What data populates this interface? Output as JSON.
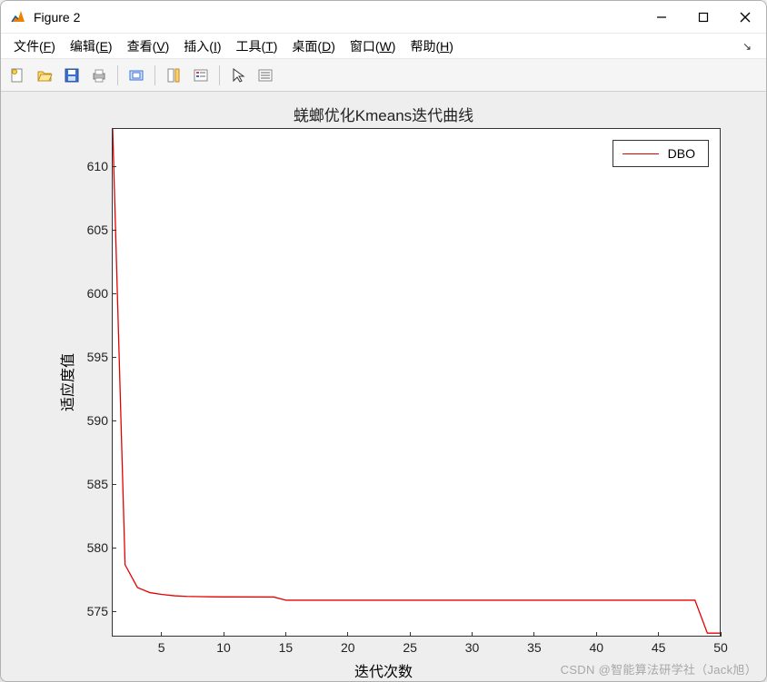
{
  "window": {
    "title": "Figure 2"
  },
  "menubar": {
    "items": [
      {
        "label": "文件(F)",
        "accel": "F"
      },
      {
        "label": "编辑(E)",
        "accel": "E"
      },
      {
        "label": "查看(V)",
        "accel": "V"
      },
      {
        "label": "插入(I)",
        "accel": "I"
      },
      {
        "label": "工具(T)",
        "accel": "T"
      },
      {
        "label": "桌面(D)",
        "accel": "D"
      },
      {
        "label": "窗口(W)",
        "accel": "W"
      },
      {
        "label": "帮助(H)",
        "accel": "H"
      }
    ]
  },
  "toolbar": {
    "icons": [
      "new-file-icon",
      "open-file-icon",
      "save-icon",
      "print-icon",
      "sep",
      "link-axes-icon",
      "sep",
      "colorbar-icon",
      "legend-icon",
      "sep",
      "pointer-icon",
      "data-cursor-icon"
    ]
  },
  "chart_data": {
    "type": "line",
    "title": "蜣螂优化Kmeans迭代曲线",
    "xlabel": "迭代次数",
    "ylabel": "适应度值",
    "xlim": [
      1,
      50
    ],
    "ylim": [
      573,
      613
    ],
    "xticks": [
      5,
      10,
      15,
      20,
      25,
      30,
      35,
      40,
      45,
      50
    ],
    "yticks": [
      575,
      580,
      585,
      590,
      595,
      600,
      605,
      610
    ],
    "series": [
      {
        "name": "DBO",
        "color": "#e30000",
        "x": [
          1,
          2,
          3,
          4,
          5,
          6,
          7,
          8,
          9,
          10,
          14,
          15,
          20,
          25,
          30,
          35,
          40,
          45,
          48,
          49,
          50
        ],
        "y": [
          613,
          578.6,
          576.8,
          576.4,
          576.25,
          576.15,
          576.1,
          576.08,
          576.07,
          576.06,
          576.05,
          575.8,
          575.8,
          575.8,
          575.8,
          575.8,
          575.8,
          575.8,
          575.8,
          573.2,
          573.2
        ]
      }
    ],
    "legend": {
      "position": "top-right",
      "entries": [
        "DBO"
      ]
    }
  },
  "watermark": "CSDN @智能算法研学社（Jack旭）"
}
